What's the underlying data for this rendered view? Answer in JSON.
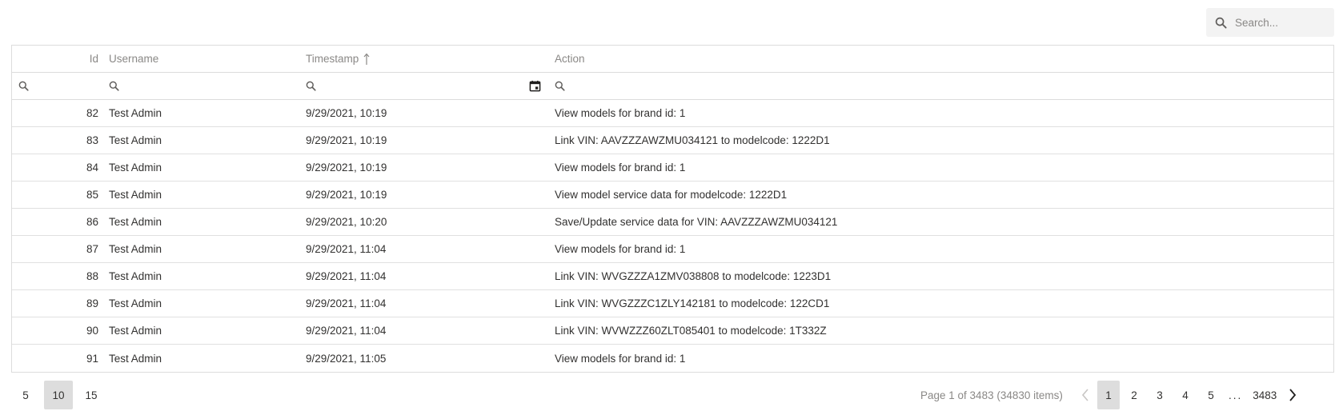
{
  "search": {
    "placeholder": "Search..."
  },
  "grid": {
    "columns": [
      {
        "key": "id",
        "label": "Id"
      },
      {
        "key": "username",
        "label": "Username"
      },
      {
        "key": "timestamp",
        "label": "Timestamp",
        "sort": "ascending"
      },
      {
        "key": "action",
        "label": "Action"
      }
    ],
    "rows": [
      {
        "id": "82",
        "username": "Test Admin",
        "timestamp": "9/29/2021, 10:19",
        "action": "View models for brand id: 1"
      },
      {
        "id": "83",
        "username": "Test Admin",
        "timestamp": "9/29/2021, 10:19",
        "action": "Link VIN: AAVZZZAWZMU034121 to modelcode: 1222D1"
      },
      {
        "id": "84",
        "username": "Test Admin",
        "timestamp": "9/29/2021, 10:19",
        "action": "View models for brand id: 1"
      },
      {
        "id": "85",
        "username": "Test Admin",
        "timestamp": "9/29/2021, 10:19",
        "action": "View model service data for modelcode: 1222D1"
      },
      {
        "id": "86",
        "username": "Test Admin",
        "timestamp": "9/29/2021, 10:20",
        "action": "Save/Update service data for VIN: AAVZZZAWZMU034121"
      },
      {
        "id": "87",
        "username": "Test Admin",
        "timestamp": "9/29/2021, 11:04",
        "action": "View models for brand id: 1"
      },
      {
        "id": "88",
        "username": "Test Admin",
        "timestamp": "9/29/2021, 11:04",
        "action": "Link VIN: WVGZZZA1ZMV038808 to modelcode: 1223D1"
      },
      {
        "id": "89",
        "username": "Test Admin",
        "timestamp": "9/29/2021, 11:04",
        "action": "Link VIN: WVGZZZC1ZLY142181 to modelcode: 122CD1"
      },
      {
        "id": "90",
        "username": "Test Admin",
        "timestamp": "9/29/2021, 11:04",
        "action": "Link VIN: WVWZZZ60ZLT085401 to modelcode: 1T332Z"
      },
      {
        "id": "91",
        "username": "Test Admin",
        "timestamp": "9/29/2021, 11:05",
        "action": "View models for brand id: 1"
      }
    ]
  },
  "pager": {
    "page_sizes": [
      "5",
      "10",
      "15"
    ],
    "selected_page_size": "10",
    "info": "Page 1 of 3483 (34830 items)",
    "pages": [
      "1",
      "2",
      "3",
      "4",
      "5"
    ],
    "ellipsis": "...",
    "last_page": "3483",
    "current_page": "1"
  },
  "colors": {
    "border": "#dcdcdc",
    "selected_bg": "#dddddd",
    "muted_text": "#8a8886",
    "text": "#323130"
  },
  "icons": {
    "search": "search-icon",
    "filter": "search-icon",
    "calendar": "calendar-icon",
    "sort": "sort-ascending-arrow-icon",
    "prev": "chevron-left-icon",
    "next": "chevron-right-icon"
  }
}
